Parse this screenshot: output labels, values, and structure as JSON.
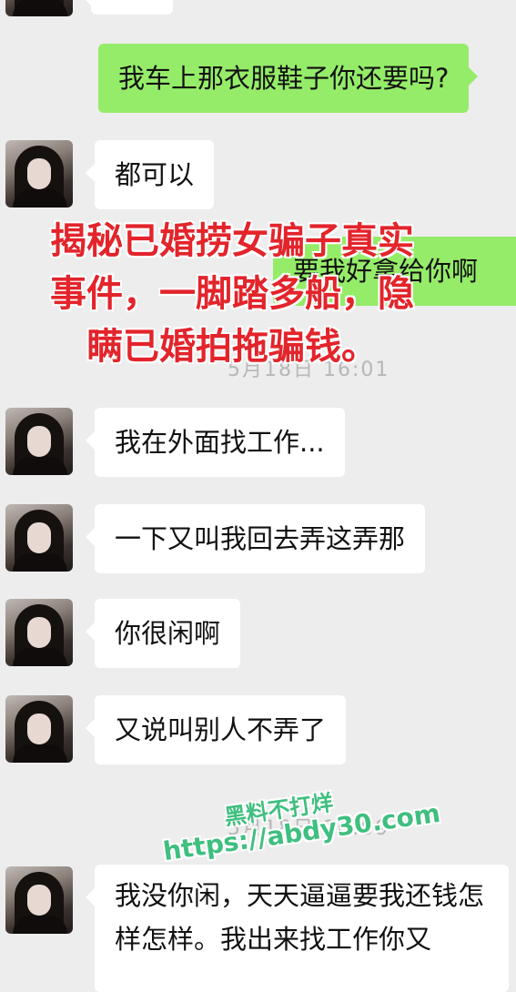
{
  "messages": [
    {
      "side": "right",
      "text": "我车上那衣服鞋子你还要吗?"
    },
    {
      "side": "left",
      "text": "都可以"
    },
    {
      "side": "right",
      "text": "要我好拿给你啊"
    },
    {
      "side": "left",
      "text": "我在外面找工作..."
    },
    {
      "side": "left",
      "text": "一下又叫我回去弄这弄那"
    },
    {
      "side": "left",
      "text": "你很闲啊"
    },
    {
      "side": "left",
      "text": "又说叫别人不弄了"
    },
    {
      "side": "left",
      "text": "我没你闲，天天逼逼要我还钱怎样怎样。我出来找工作你又"
    }
  ],
  "timestamps": [
    "5月18日 16:01",
    "5月18日 16:09"
  ],
  "overlay": {
    "title": "揭秘已婚捞女骗子真实事件，一脚踏多船，隐瞒已婚拍拖骗钱。"
  },
  "watermark": {
    "line1": "黑料不打烊",
    "line2": "https://abdy30.com"
  },
  "colors": {
    "background": "#ededed",
    "bubble_self": "#95ec69",
    "bubble_other": "#ffffff",
    "overlay_text": "#e3242b",
    "watermark": "#3fbf7f"
  }
}
